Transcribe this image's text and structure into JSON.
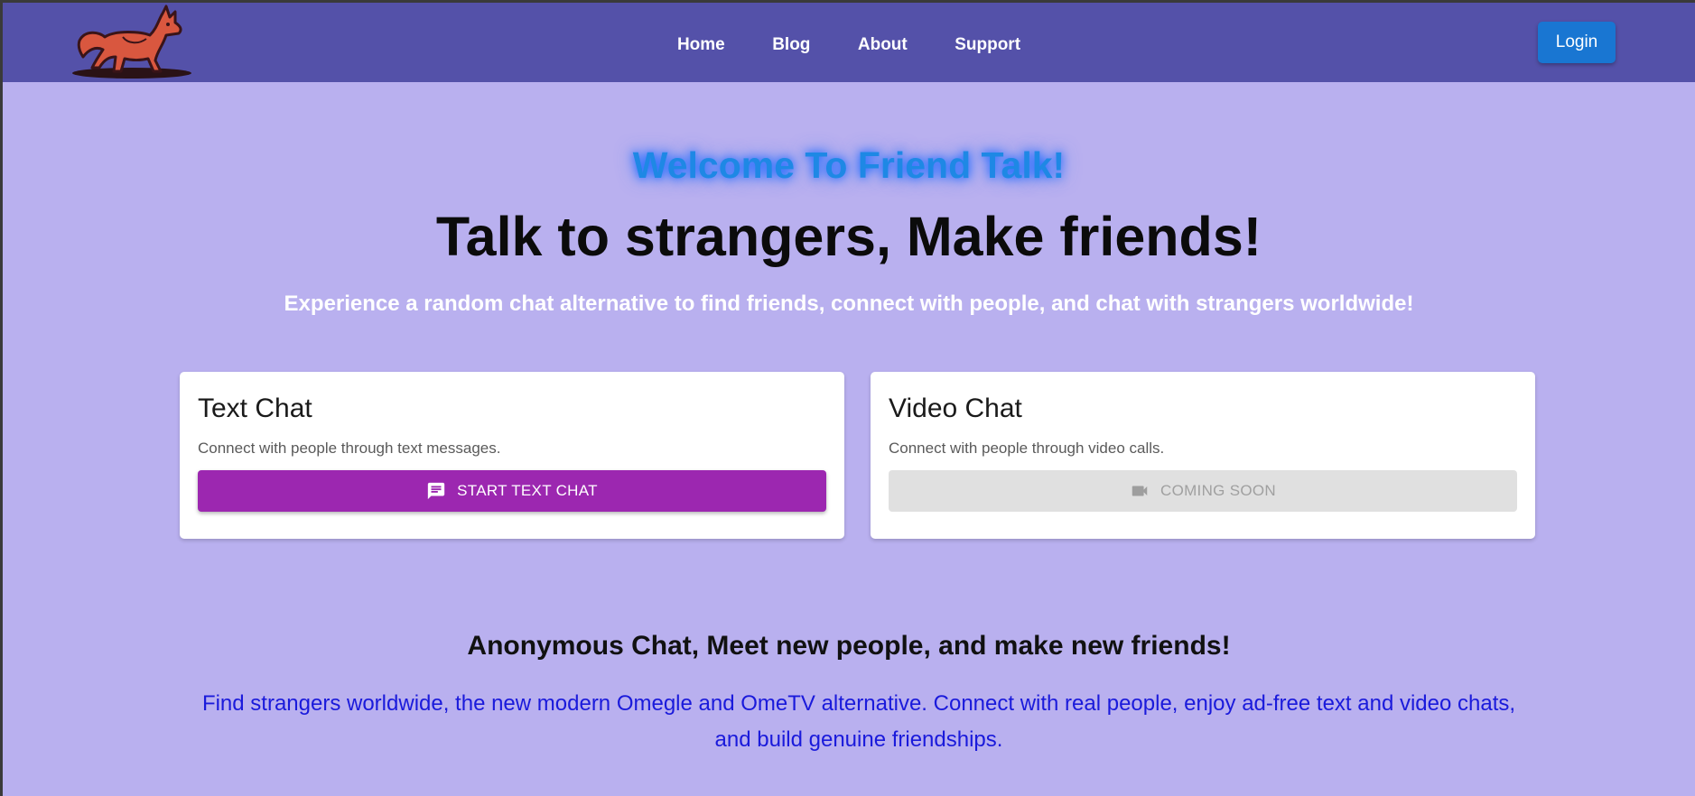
{
  "nav": {
    "links": [
      "Home",
      "Blog",
      "About",
      "Support"
    ],
    "login_label": "Login"
  },
  "hero": {
    "welcome": "Welcome To Friend Talk!",
    "title": "Talk to strangers, Make friends!",
    "subtitle": "Experience a random chat alternative to find friends, connect with people, and chat with strangers worldwide!"
  },
  "cards": [
    {
      "title": "Text Chat",
      "description": "Connect with people through text messages.",
      "button_label": "START TEXT CHAT",
      "button_icon": "chat-icon"
    },
    {
      "title": "Video Chat",
      "description": "Connect with people through video calls.",
      "button_label": "COMING SOON",
      "button_icon": "videocam-icon"
    }
  ],
  "section": {
    "title": "Anonymous Chat, Meet new people, and make new friends!",
    "text": "Find strangers worldwide, the new modern Omegle and OmeTV alternative. Connect with real people, enjoy ad-free text and video chats, and build genuine friendships."
  },
  "colors": {
    "navbar": "#5451a9",
    "background": "#b9b0ef",
    "login_button": "#1976d2",
    "primary_button": "#9c27b0",
    "welcome_text": "#1e88e5",
    "section_text": "#1a1adb"
  }
}
